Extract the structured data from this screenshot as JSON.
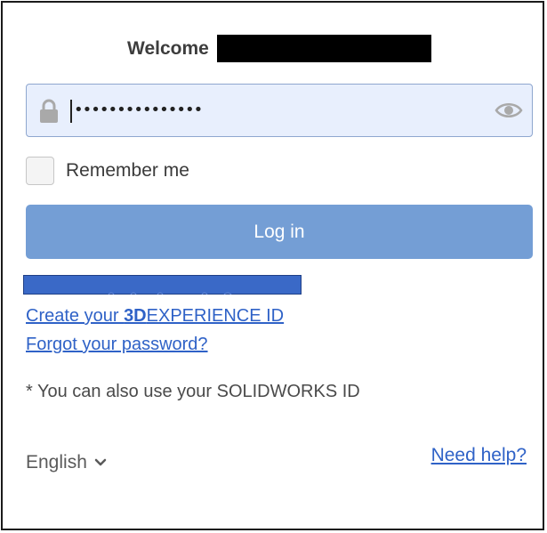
{
  "header": {
    "welcome_label": "Welcome"
  },
  "password": {
    "masked_value": "•••••••••••••••",
    "lock_icon": "lock-icon",
    "visibility_icon": "eye-icon"
  },
  "remember": {
    "label": "Remember me",
    "checked": false
  },
  "login": {
    "button_label": "Log in",
    "color": "#749ed5"
  },
  "links": {
    "create_prefix": "Create your ",
    "create_bold": "3D",
    "create_suffix": "EXPERIENCE ID",
    "forgot": "Forgot your password?",
    "need_help": "Need help?",
    "color": "#2f62c7"
  },
  "note": "* You can also use your SOLIDWORKS ID",
  "language": {
    "selected": "English",
    "icon": "chevron-down-icon"
  },
  "redaction_color": "#3a69c7"
}
